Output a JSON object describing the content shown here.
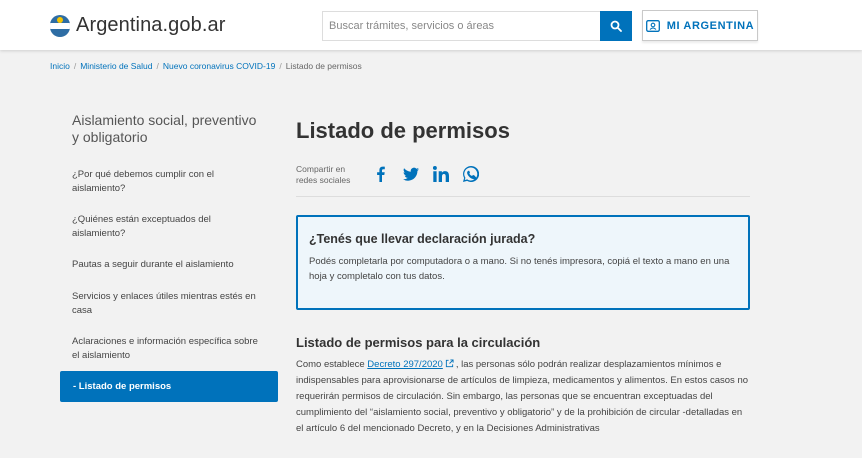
{
  "header": {
    "brand_name": "Argentina.gob.ar",
    "search_placeholder": "Buscar trámites, servicios o áreas",
    "mi_argentina_label": "MI ARGENTINA"
  },
  "breadcrumb": {
    "items": [
      "Inicio",
      "Ministerio de Salud",
      "Nuevo coronavirus COVID-19"
    ],
    "current": "Listado de permisos"
  },
  "sidebar": {
    "title": "Aislamiento social, preventivo y obligatorio",
    "items": [
      {
        "label": "¿Por qué debemos cumplir con el aislamiento?"
      },
      {
        "label": "¿Quiénes están exceptuados del aislamiento?"
      },
      {
        "label": "Pautas a seguir durante el aislamiento"
      },
      {
        "label": "Servicios y enlaces útiles mientras estés en casa"
      },
      {
        "label": "Aclaraciones e información específica sobre el aislamiento"
      },
      {
        "label": "-   Listado de permisos",
        "active": true
      }
    ]
  },
  "main": {
    "title": "Listado de permisos",
    "share_label": "Compartir en redes sociales",
    "share_icons": [
      "facebook-icon",
      "twitter-icon",
      "linkedin-icon",
      "whatsapp-icon"
    ],
    "alert": {
      "title": "¿Tenés que llevar declaración jurada?",
      "text": "Podés completarla por computadora o a mano. Si no tenés impresora, copiá el texto a mano en una hoja y completalo con tus datos."
    },
    "section": {
      "title": "Listado de permisos para la circulación",
      "text_before_link": "Como establece ",
      "link_text": "Decreto 297/2020",
      "text_after_link": ", las personas sólo podrán realizar desplazamientos mínimos e indispensables para aprovisionarse de artículos de limpieza, medicamentos y alimentos. En estos casos no requerirán permisos de circulación. Sin embargo, las personas que se encuentran exceptuadas del cumplimiento del “aislamiento social, preventivo y obligatorio” y de la prohibición de circular -detalladas en el artículo 6 del mencionado Decreto, y en la Decisiones Administrativas"
    }
  },
  "colors": {
    "accent": "#0072bb",
    "alert_bg": "#eef6fb",
    "page_bg": "#f2f2f2"
  }
}
